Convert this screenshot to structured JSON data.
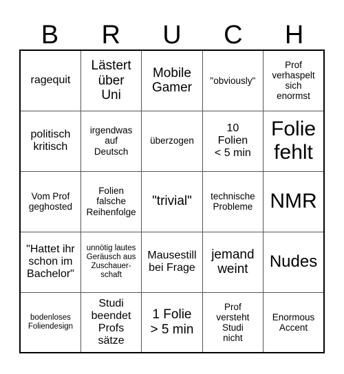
{
  "card": {
    "header_letters": [
      "B",
      "R",
      "U",
      "C",
      "H"
    ],
    "rows": [
      [
        {
          "text": "ragequit",
          "size": "m"
        },
        {
          "text": "Lästert\nüber\nUni",
          "size": "l"
        },
        {
          "text": "Mobile\nGamer",
          "size": "l"
        },
        {
          "text": "\"obviously\"",
          "size": "s"
        },
        {
          "text": "Prof\nverhaspelt\nsich\nenormst",
          "size": "s"
        }
      ],
      [
        {
          "text": "politisch\nkritisch",
          "size": "m"
        },
        {
          "text": "irgendwas\nauf\nDeutsch",
          "size": "s"
        },
        {
          "text": "überzogen",
          "size": "s"
        },
        {
          "text": "10\nFolien\n< 5 min",
          "size": "m"
        },
        {
          "text": "Folie\nfehlt",
          "size": "xxl"
        }
      ],
      [
        {
          "text": "Vom Prof\ngeghosted",
          "size": "s"
        },
        {
          "text": "Folien\nfalsche\nReihenfolge",
          "size": "s"
        },
        {
          "text": "\"trivial\"",
          "size": "l"
        },
        {
          "text": "technische\nProbleme",
          "size": "s"
        },
        {
          "text": "NMR",
          "size": "xxl"
        }
      ],
      [
        {
          "text": "\"Hattet ihr\nschon im\nBachelor\"",
          "size": "m"
        },
        {
          "text": "unnötig lautes\nGeräusch aus\nZuschauer-\nschaft",
          "size": "xs"
        },
        {
          "text": "Mausestill\nbei Frage",
          "size": "m"
        },
        {
          "text": "jemand\nweint",
          "size": "l"
        },
        {
          "text": "Nudes",
          "size": "xl"
        }
      ],
      [
        {
          "text": "bodenloses\nFoliendesign",
          "size": "xs"
        },
        {
          "text": "Studi\nbeendet\nProfs\nsätze",
          "size": "m"
        },
        {
          "text": "1 Folie\n> 5 min",
          "size": "l"
        },
        {
          "text": "Prof\nversteht\nStudi\nnicht",
          "size": "s"
        },
        {
          "text": "Enormous\nAccent",
          "size": "s"
        }
      ]
    ]
  }
}
